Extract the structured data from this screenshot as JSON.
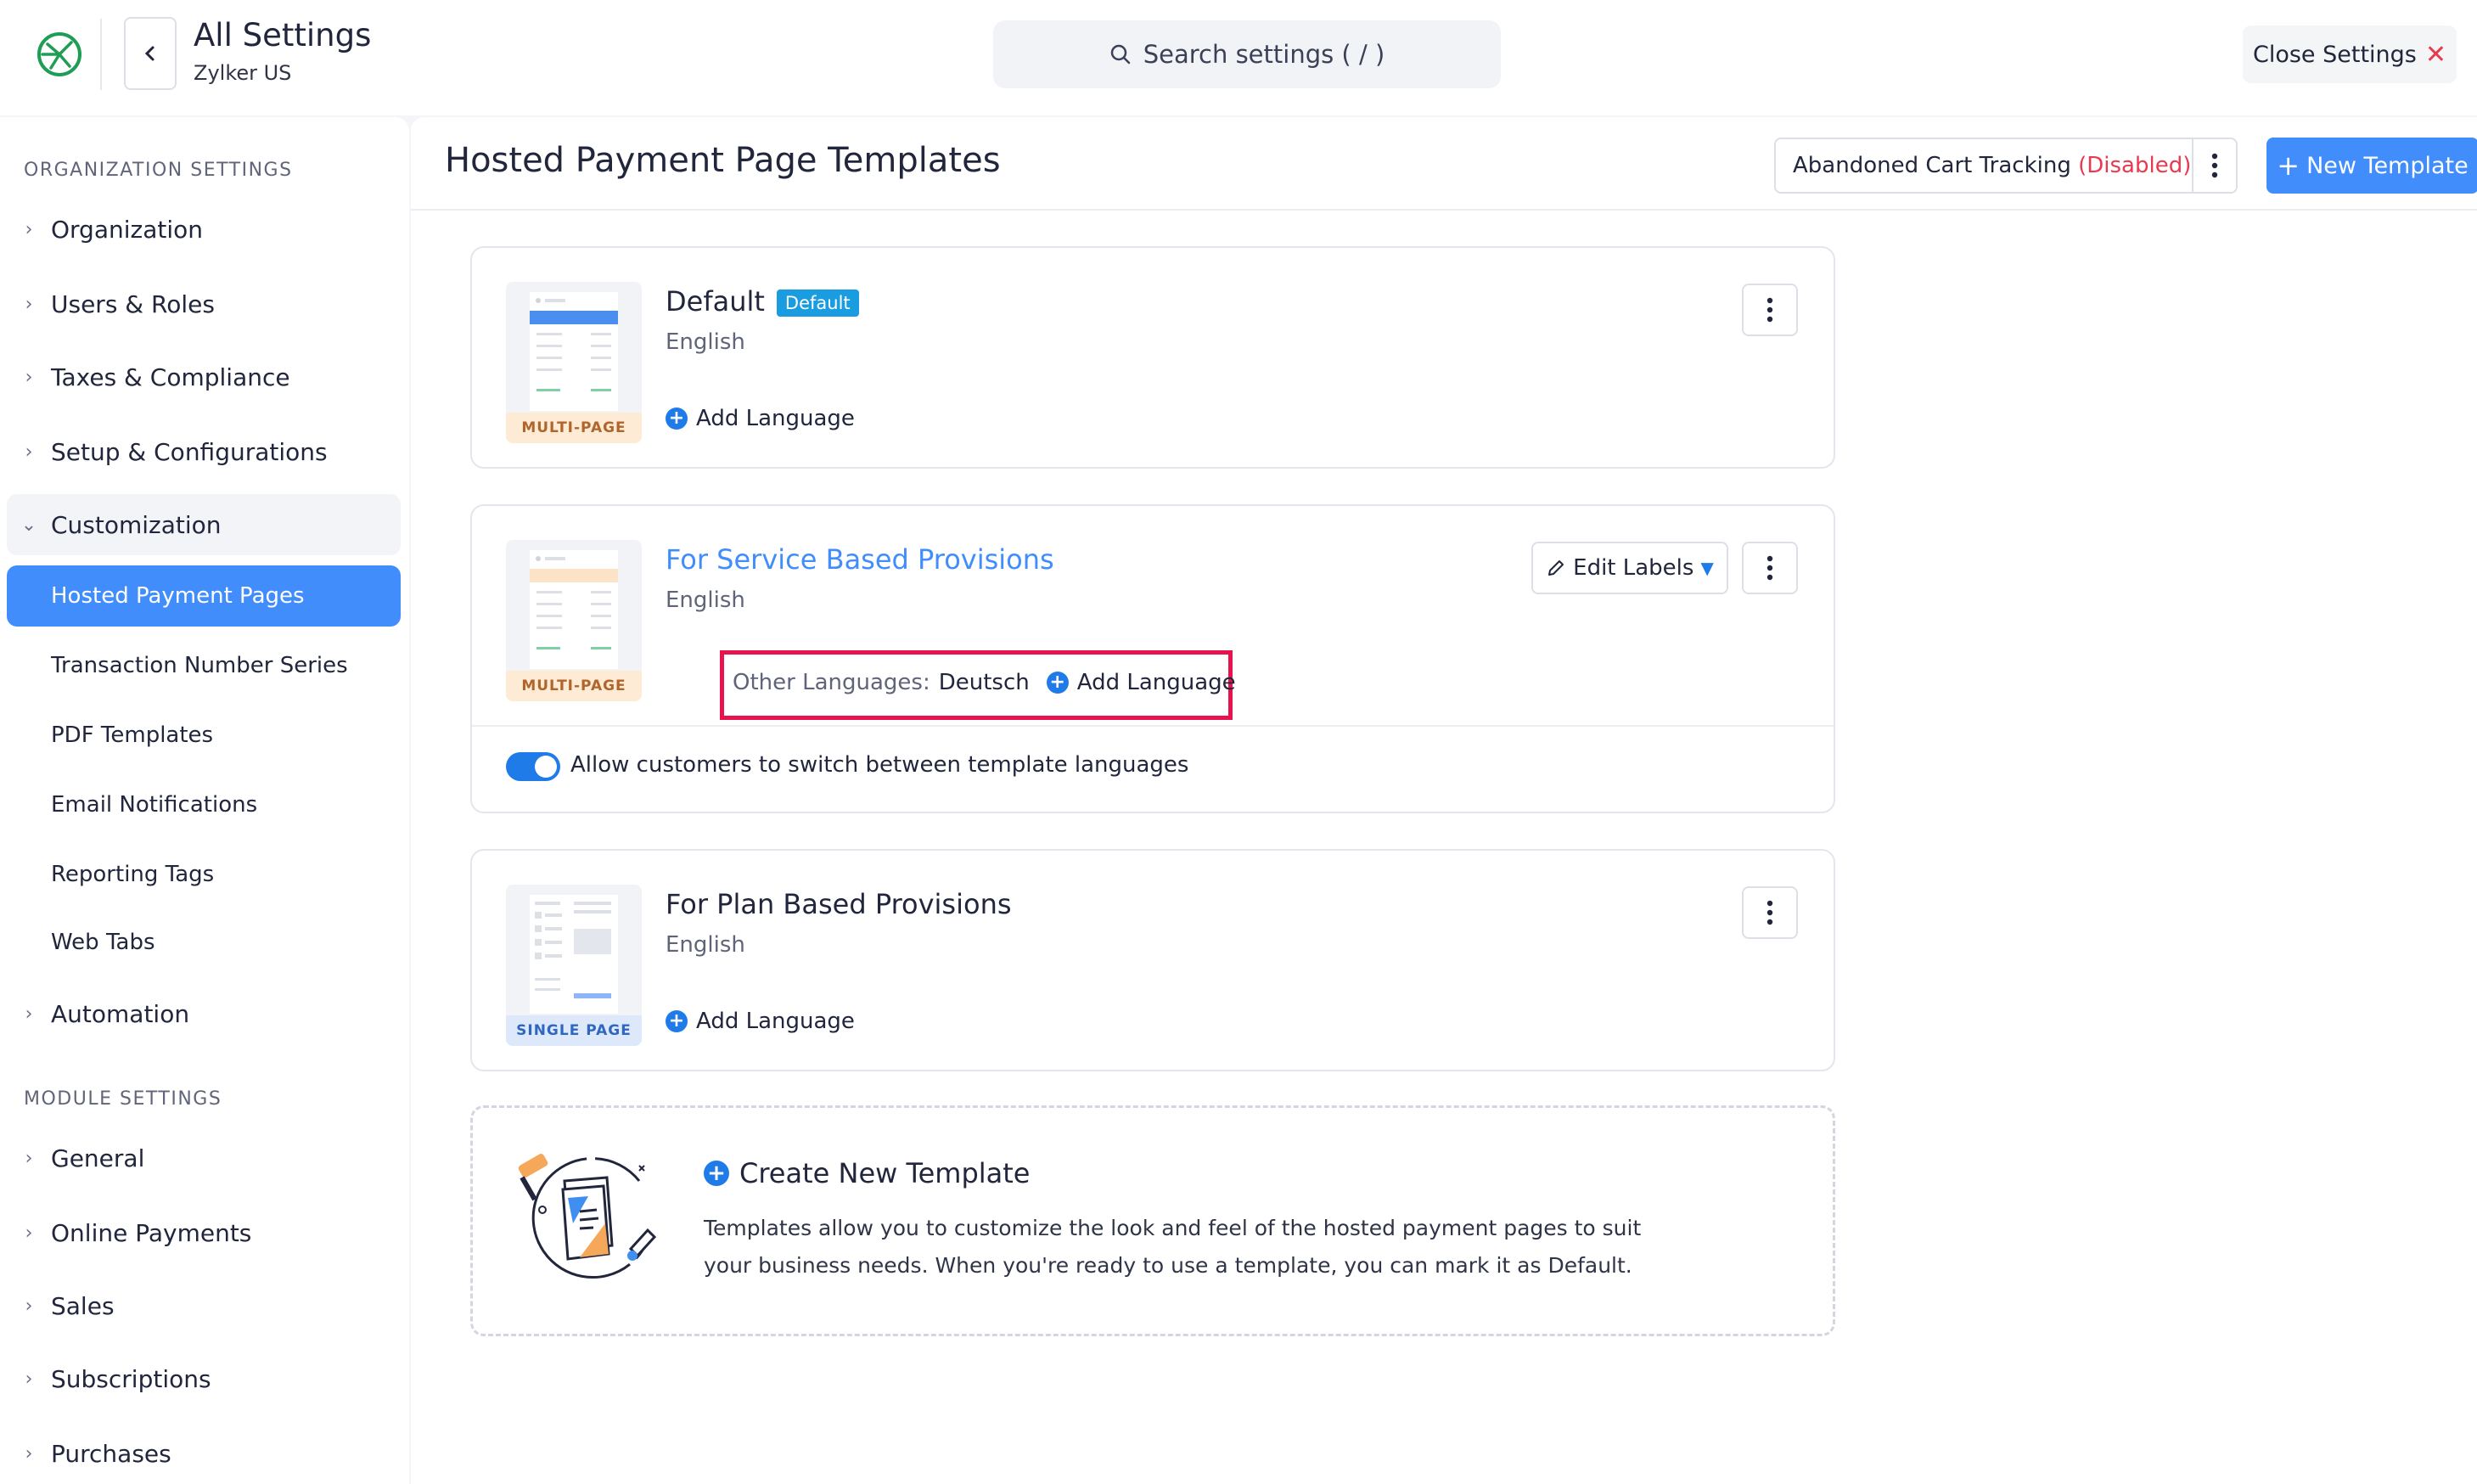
{
  "header": {
    "title": "All Settings",
    "org": "Zylker US",
    "search_placeholder": "Search settings ( / )",
    "close_label": "Close Settings"
  },
  "sidebar": {
    "org_section": "ORGANIZATION SETTINGS",
    "items": {
      "organization": "Organization",
      "users_roles": "Users & Roles",
      "taxes": "Taxes & Compliance",
      "setup": "Setup & Configurations",
      "customization": "Customization",
      "hosted_pages": "Hosted Payment Pages",
      "txn_series": "Transaction Number Series",
      "pdf_templates": "PDF Templates",
      "email_notifications": "Email Notifications",
      "reporting_tags": "Reporting Tags",
      "web_tabs": "Web Tabs",
      "automation": "Automation"
    },
    "module_section": "MODULE SETTINGS",
    "module_items": {
      "general": "General",
      "online_payments": "Online Payments",
      "sales": "Sales",
      "subscriptions": "Subscriptions",
      "purchases": "Purchases"
    }
  },
  "main": {
    "title": "Hosted Payment Page Templates",
    "abandoned_label": "Abandoned Cart Tracking",
    "abandoned_status": "(Disabled)",
    "new_template": "New Template"
  },
  "templates": [
    {
      "name": "Default",
      "badge": "Default",
      "language": "English",
      "tag": "MULTI-PAGE",
      "add_language": "Add Language"
    },
    {
      "name": "For Service Based Provisions",
      "language": "English",
      "tag": "MULTI-PAGE",
      "other_languages_label": "Other Languages:",
      "other_languages_value": "Deutsch",
      "add_language": "Add Language",
      "edit_labels": "Edit Labels",
      "toggle_label": "Allow customers to switch between template languages",
      "toggle_on": true
    },
    {
      "name": "For Plan Based Provisions",
      "language": "English",
      "tag": "SINGLE PAGE",
      "add_language": "Add Language"
    }
  ],
  "create": {
    "title": "Create New Template",
    "description": "Templates allow you to customize the look and feel of the hosted payment pages to suit your business needs. When you're ready to use a template, you can mark it as Default."
  },
  "colors": {
    "accent": "#408dfb",
    "danger": "#e8394f",
    "highlight": "#e8124f",
    "default_badge": "#1a9de0"
  }
}
